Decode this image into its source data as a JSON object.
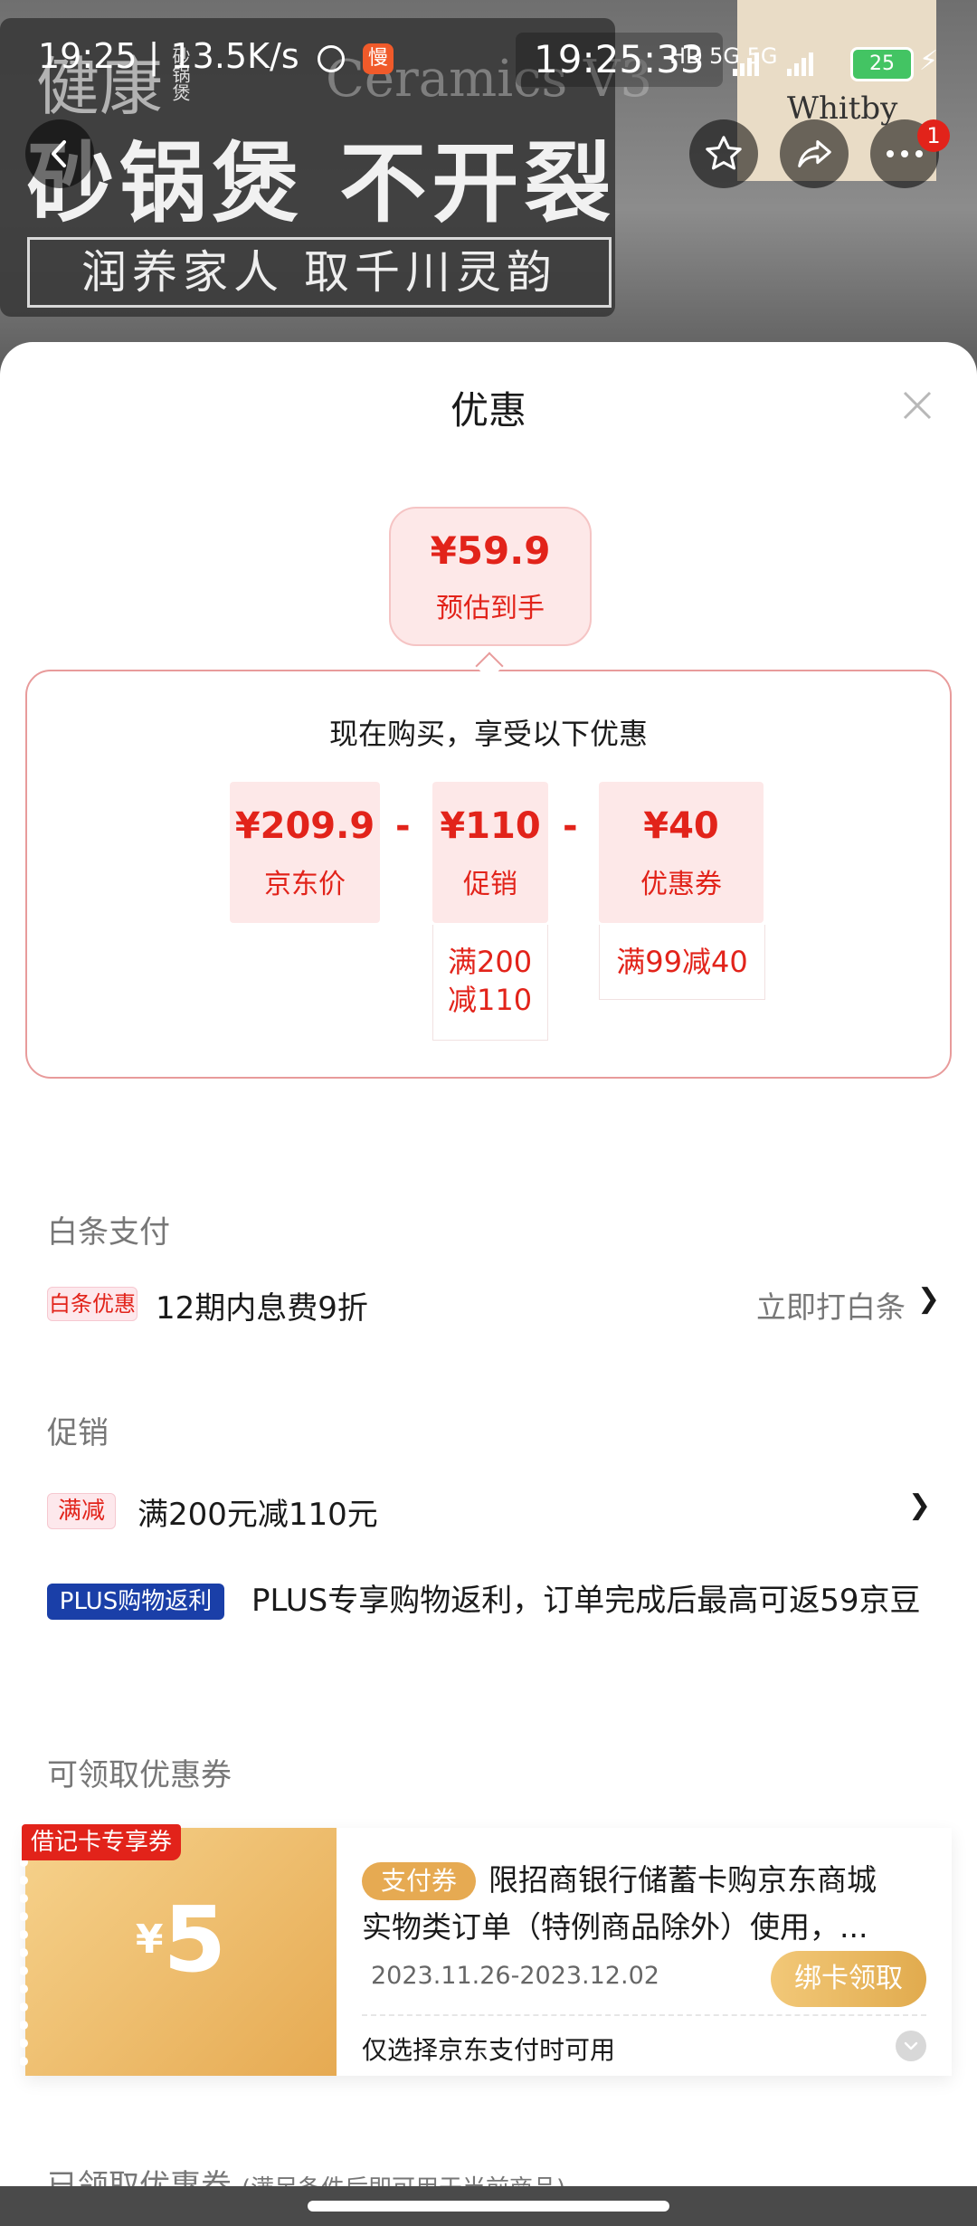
{
  "status_bar": {
    "time": "19:25",
    "net_speed": "13.5K/s",
    "slow_label": "慢",
    "center_time": "19:25:33",
    "network_labels": "HD 5G 5G",
    "battery": "25"
  },
  "background": {
    "brand_text": "健康",
    "brand_small": "砂锅煲",
    "latin_text": "Ceramics V3",
    "headline": "砂锅煲 不开裂",
    "banner": "润养家人 取千川灵韵",
    "right_text": "Whitby"
  },
  "nav": {
    "notification_count": "1"
  },
  "sheet": {
    "title": "优惠"
  },
  "estimate": {
    "price": "¥59.9",
    "label": "预估到手"
  },
  "calc": {
    "title": "现在购买，享受以下优惠",
    "items": [
      {
        "price": "¥209.9",
        "label": "京东价"
      },
      {
        "price": "¥110",
        "label": "促销",
        "sub": "满200减110"
      },
      {
        "price": "¥40",
        "label": "优惠券",
        "sub": "满99减40"
      }
    ],
    "operator": "-"
  },
  "baitiao": {
    "section_title": "白条支付",
    "tag": "白条优惠",
    "text": "12期内息费9折",
    "action": "立即打白条"
  },
  "promo": {
    "section_title": "促销",
    "rows": [
      {
        "tag": "满减",
        "text": "满200元减110元"
      },
      {
        "tag": "PLUS购物返利",
        "text": "PLUS专享购物返利，订单完成后最高可返59京豆"
      }
    ]
  },
  "coupons": {
    "section_title": "可领取优惠券",
    "items": [
      {
        "corner_tag": "借记卡专享券",
        "currency": "¥",
        "amount": "5",
        "type_pill": "支付券",
        "desc_line1": "限招商银行储蓄卡购京东商城",
        "desc_line2": "实物类订单（特例商品除外）使用，...",
        "date": "2023.11.26-2023.12.02",
        "button": "绑卡领取",
        "note": "仅选择京东支付时可用"
      }
    ]
  },
  "claimed": {
    "section_title": "已领取优惠券",
    "subtitle": "(满足条件后即可用于当前商品)"
  },
  "colors": {
    "accent_red": "#e2231a",
    "soft_red_bg": "#fde8e8",
    "coupon_gold": "#e6aa52",
    "plus_blue": "#1a3fa8"
  }
}
